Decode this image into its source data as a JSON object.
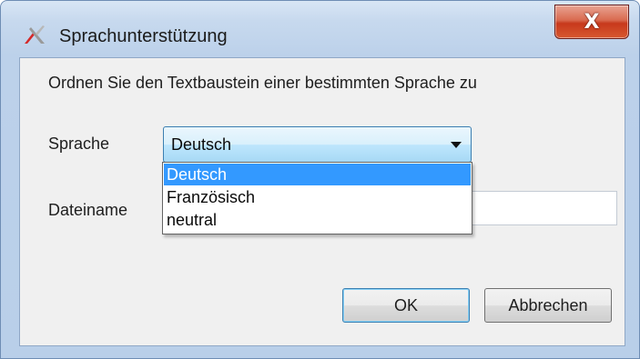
{
  "window": {
    "title": "Sprachunterstützung",
    "close_label": "X"
  },
  "dialog": {
    "instruction": "Ordnen Sie den Textbaustein einer bestimmten Sprache zu",
    "language_label": "Sprache",
    "filename_label": "Dateiname",
    "filename_value": ""
  },
  "language_select": {
    "selected": "Deutsch",
    "options": [
      "Deutsch",
      "Französisch",
      "neutral"
    ],
    "highlighted_index": 0
  },
  "buttons": {
    "ok_label": "OK",
    "cancel_label": "Abbrechen"
  },
  "colors": {
    "selection": "#3399ff",
    "close_button": "#c7391c",
    "frame": "#bcd1ea"
  }
}
